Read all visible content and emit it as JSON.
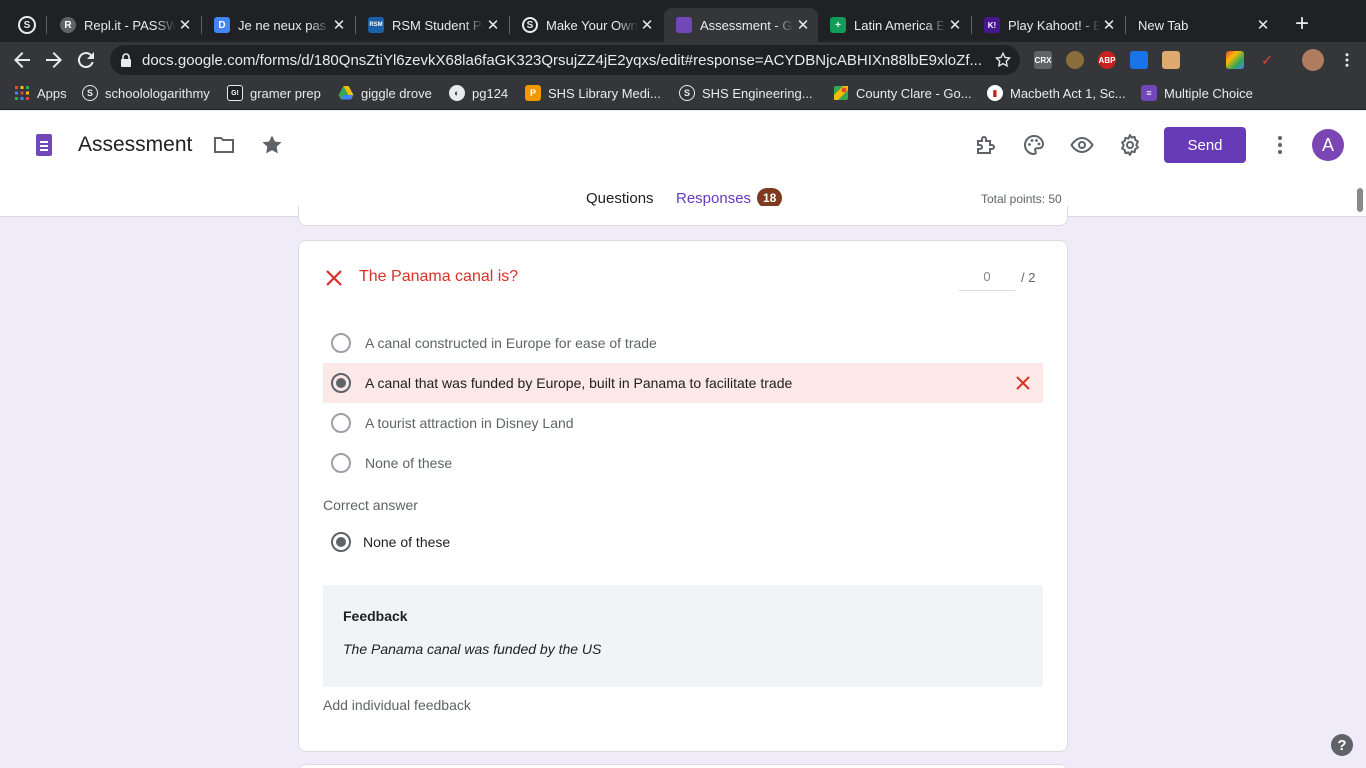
{
  "browser": {
    "tabs": [
      {
        "label": "",
        "favicon": "S"
      },
      {
        "label": "Repl.it - PASSWORD",
        "favicon": "R"
      },
      {
        "label": "Je ne neux pas faire",
        "favicon": "D"
      },
      {
        "label": "RSM Student Portal",
        "favicon": "RSM"
      },
      {
        "label": "Make Your Own",
        "favicon": "S"
      },
      {
        "label": "Assessment - Google Forms",
        "favicon": "F"
      },
      {
        "label": "Latin America Exam",
        "favicon": "+"
      },
      {
        "label": "Play Kahoot! - Enter",
        "favicon": "K!"
      },
      {
        "label": "New Tab",
        "favicon": ""
      }
    ],
    "url": "docs.google.com/forms/d/180QnsZtiYl6zevkX68la6faGK323QrsujZZ4jE2yqxs/edit#response=ACYDBNjcABHIXn88lbE9xloZf...",
    "extensions": [
      "CRX",
      "",
      "ABP",
      "",
      "",
      "",
      "",
      ""
    ],
    "bookmarks": [
      {
        "label": "Apps",
        "icon": "apps-grid-icon"
      },
      {
        "label": "schoolologarithmy",
        "icon": "S"
      },
      {
        "label": "gramer prep",
        "icon": "G!"
      },
      {
        "label": "giggle drove",
        "icon": "drive-icon"
      },
      {
        "label": "pg124",
        "icon": "globe-icon"
      },
      {
        "label": "SHS Library Medi...",
        "icon": "library-icon"
      },
      {
        "label": "SHS Engineering...",
        "icon": "S"
      },
      {
        "label": "County Clare - Go...",
        "icon": "maps-icon"
      },
      {
        "label": "Macbeth Act 1, Sc...",
        "icon": "chart-icon"
      },
      {
        "label": "Multiple Choice",
        "icon": "forms-icon"
      }
    ]
  },
  "app": {
    "title": "Assessment",
    "send_label": "Send",
    "avatar_initial": "A",
    "tabs": {
      "questions": "Questions",
      "responses": "Responses",
      "responses_count": "18"
    },
    "total_points": "Total points: 50"
  },
  "question": {
    "title": "The Panama canal is?",
    "score": "0",
    "max_score": "/ 2",
    "options": [
      {
        "label": "A canal constructed in Europe for ease of trade",
        "selected": false,
        "wrong": false
      },
      {
        "label": "A canal that was funded by Europe, built in Panama to facilitate trade",
        "selected": true,
        "wrong": true
      },
      {
        "label": "A tourist attraction in Disney Land",
        "selected": false,
        "wrong": false
      },
      {
        "label": "None of these",
        "selected": false,
        "wrong": false
      }
    ],
    "correct_answer_label": "Correct answer",
    "correct_answer": "None of these",
    "feedback_title": "Feedback",
    "feedback_text": "The Panama canal was funded by the US",
    "add_feedback": "Add individual feedback"
  },
  "colors": {
    "accent": "#673ab7",
    "wrong": "#d93025",
    "background": "#f0ebf8"
  }
}
